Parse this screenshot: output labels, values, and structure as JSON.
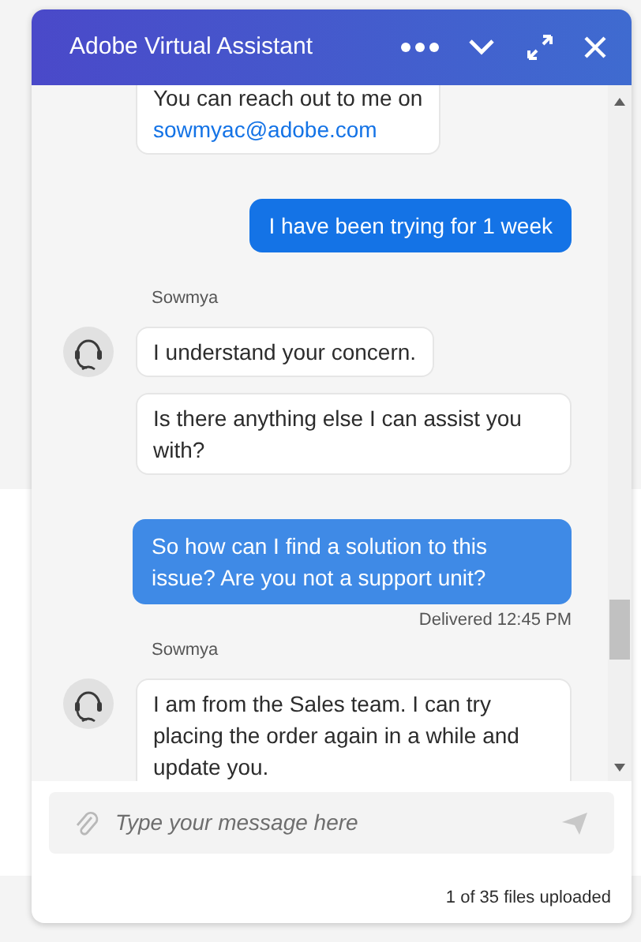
{
  "header": {
    "title": "Adobe Virtual Assistant"
  },
  "messages": [
    {
      "kind": "agent_bubble",
      "text": "You can reach out to me on",
      "link": "sowmyac@adobe.com",
      "avatar": false
    },
    {
      "kind": "user_bubble",
      "text": "I have been trying for 1 week",
      "color": "#1473e6"
    },
    {
      "kind": "sender",
      "text": "Sowmya"
    },
    {
      "kind": "agent_bubble",
      "text": "I understand your concern.",
      "avatar": true
    },
    {
      "kind": "agent_bubble",
      "text": "Is there anything else I can assist you with?",
      "avatar": false
    },
    {
      "kind": "user_bubble",
      "text": "So how can I find a solution to this issue? Are you not a support unit?",
      "color": "#3f8ae6"
    },
    {
      "kind": "status",
      "text": "Delivered 12:45 PM"
    },
    {
      "kind": "sender",
      "text": "Sowmya"
    },
    {
      "kind": "agent_bubble",
      "text": "I am from the Sales team. I can try placing the order again in a while and update you.",
      "avatar": true
    }
  ],
  "composer": {
    "placeholder": "Type your message here"
  },
  "footer": {
    "upload_status": "1 of 35 files uploaded"
  }
}
